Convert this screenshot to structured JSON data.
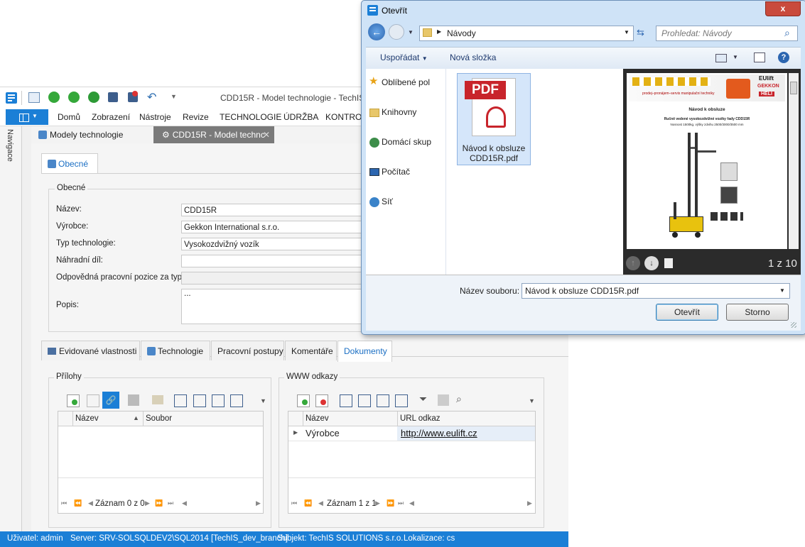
{
  "app": {
    "window_title": "CDD15R - Model technologie - TechIS",
    "menu": [
      "Domů",
      "Zobrazení",
      "Nástroje",
      "Revize",
      "TECHNOLOGIE",
      "ÚDRŽBA",
      "KONTROLY"
    ],
    "nav_label": "Navigace",
    "doc_tabs": [
      "Modely technologie",
      "CDD15R - Model technc"
    ],
    "tab_general": "Obecné",
    "group_general": "Obecné",
    "fields": {
      "nazev_label": "Název:",
      "nazev_value": "CDD15R",
      "vyrobce_label": "Výrobce:",
      "vyrobce_value": "Gekkon International s.r.o.",
      "typ_label": "Typ technologie:",
      "typ_value": "Vysokozdvižný vozík",
      "nahradni_label": "Náhradní díl:",
      "nahradni_value": "",
      "pozice_label": "Odpovědná pracovní pozice za typ:",
      "pozice_value": "",
      "popis_label": "Popis:",
      "popis_value": "..."
    },
    "bottom_tabs": [
      "Evidované vlastnosti",
      "Technologie",
      "Pracovní postupy",
      "Komentáře",
      "Dokumenty"
    ],
    "prilohy": {
      "title": "Přílohy",
      "columns": [
        "Název",
        "Soubor"
      ],
      "record_text": "Záznam 0 z 0"
    },
    "www": {
      "title": "WWW odkazy",
      "columns": [
        "Název",
        "URL odkaz"
      ],
      "rows": [
        {
          "name": "Výrobce",
          "url": "http://www.eulift.cz"
        }
      ],
      "record_text": "Záznam 1 z 1"
    },
    "status": {
      "user": "Uživatel: admin",
      "server": "Server: SRV-SOLSQLDEV2\\SQL2014 [TechIS_dev_branch]",
      "subject": "Subjekt: TechIS SOLUTIONS s.r.o.",
      "locale": "Lokalizace: cs"
    }
  },
  "dialog": {
    "title": "Otevřít",
    "close": "x",
    "address": "Návody",
    "search_placeholder": "Prohledat: Návody",
    "organize": "Uspořádat",
    "new_folder": "Nová složka",
    "nav_items": [
      "Oblíbené pol",
      "Knihovny",
      "Domácí skup",
      "Počítač",
      "Síť"
    ],
    "file": {
      "icon_text": "PDF",
      "name_line1": "Návod k obsluze",
      "name_line2": "CDD15R.pdf"
    },
    "preview": {
      "brand": "EUlift",
      "brand2": "GEKKON",
      "brand3": "HELI",
      "header_text": "prodej–pronájem–servis manipulační techniky",
      "heading": "Návod k obsluze",
      "subheading": "Ručně vedené vysokozdvižné vozíky řady CDD15R",
      "subheading2": "Nosnost 1500kg, výšky zdvihu 2500/3000/3500 mm",
      "page_counter": "1 z 10"
    },
    "filename_label": "Název souboru:",
    "filename_value": "Návod k obsluze CDD15R.pdf",
    "open_button": "Otevřít",
    "cancel_button": "Storno",
    "colors": {
      "accent": "#1b7fd6",
      "pdf_red": "#c8242b"
    }
  }
}
